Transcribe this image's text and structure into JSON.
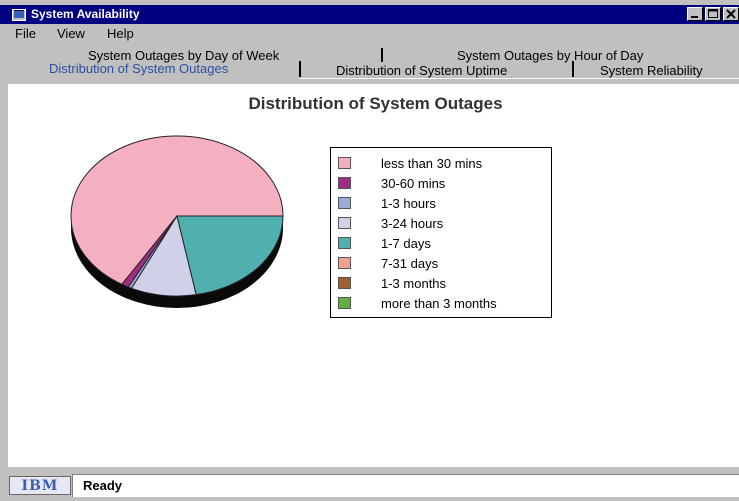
{
  "window": {
    "title": "System Availability",
    "controls": [
      "minimize",
      "maximize",
      "close"
    ]
  },
  "menu": {
    "items": [
      {
        "label": "File",
        "mnemonic": "F"
      },
      {
        "label": "View",
        "mnemonic": "V"
      },
      {
        "label": "Help",
        "mnemonic": "H"
      }
    ]
  },
  "tabs": {
    "back_row": [
      "System Outages by Day of Week",
      "System Outages by Hour of Day"
    ],
    "front_row": [
      "Distribution of System Outages",
      "Distribution of System Uptime",
      "System Reliability"
    ],
    "selected": "Distribution of System Outages"
  },
  "chart_data": {
    "type": "pie",
    "title": "Distribution of System Outages",
    "legend_position": "right",
    "categories": [
      "less than 30 mins",
      "30-60 mins",
      "1-3 hours",
      "3-24 hours",
      "1-7 days",
      "7-31 days",
      "1-3 months",
      "more than 3 months"
    ],
    "values": [
      0.6,
      0.01,
      0.005,
      0.09,
      0.2,
      0,
      0,
      0
    ],
    "colors": [
      "#f4b0c0",
      "#a02c86",
      "#9aaad8",
      "#d0d0e8",
      "#50b0b0",
      "#f4a090",
      "#a06030",
      "#60b040"
    ]
  },
  "status": {
    "logo_text": "IBM",
    "text": "Ready"
  }
}
